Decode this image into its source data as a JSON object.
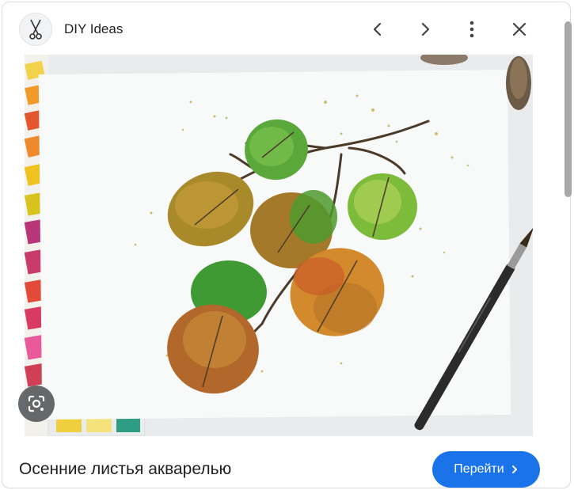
{
  "header": {
    "site_name": "DIY Ideas",
    "logo_icon": "scissors-icon",
    "prev_icon": "chevron-left-icon",
    "next_icon": "chevron-right-icon",
    "more_icon": "more-vert-icon",
    "close_icon": "close-icon"
  },
  "image": {
    "lens_icon": "google-lens-icon"
  },
  "footer": {
    "caption": "Осенние листья акварелью",
    "go_label": "Перейти",
    "go_icon": "chevron-right-icon"
  },
  "colors": {
    "accent": "#1a73e8",
    "text": "#202124"
  }
}
